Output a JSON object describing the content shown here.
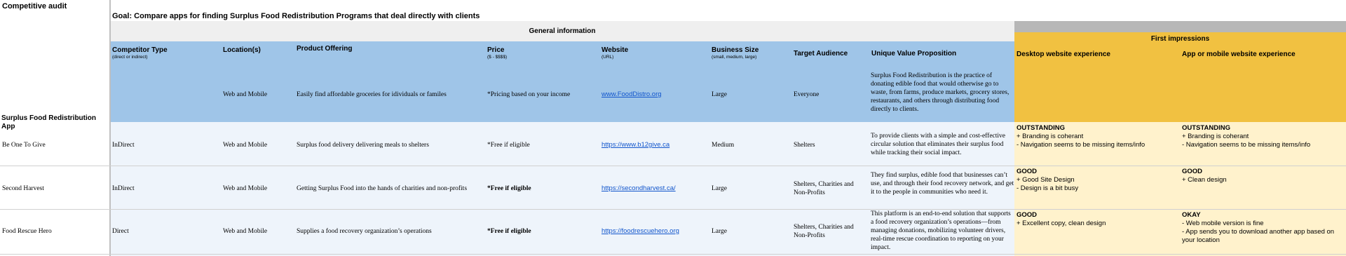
{
  "sheet": {
    "title": "Competitive audit",
    "goal": "Goal: Compare apps for finding Surplus Food Redistribution Programs that deal directly with clients",
    "app_label": "Surplus Food Redistribution App"
  },
  "groups": {
    "general": "General information",
    "impressions": "First impressions"
  },
  "columns": [
    {
      "label": "Competitor Type",
      "sub": "(direct or indirect)"
    },
    {
      "label": "Location(s)",
      "sub": ""
    },
    {
      "label": "Product Offering",
      "sub": ""
    },
    {
      "label": "Price",
      "sub": "($ - $$$$)"
    },
    {
      "label": "Website",
      "sub": "(URL)"
    },
    {
      "label": "Business Size",
      "sub": "(small, medium, large)"
    },
    {
      "label": "Target Audience",
      "sub": ""
    },
    {
      "label": "Unique Value Proposition",
      "sub": ""
    },
    {
      "label": "Desktop website experience",
      "sub": ""
    },
    {
      "label": "App or mobile website experience",
      "sub": ""
    }
  ],
  "own_app": {
    "type": "",
    "location": "Web and Mobile",
    "offering": "Easily find affordable groceries for idividuals or familes",
    "price": "*Pricing based on your income",
    "website": "www.FoodDistro.org",
    "size": "Large",
    "audience": "Everyone",
    "uvp": "Surplus Food Redistribution is the practice of donating edible food that would otherwise go to waste, from farms, produce markets, grocery stores, restaurants, and others through distributing food directly to clients."
  },
  "rows": [
    {
      "name": "Be One To Give",
      "type": "InDirect",
      "location": "Web and Mobile",
      "offering": "Surplus food delivery delivering meals to shelters",
      "price": "*Free if eligible",
      "website": "https://www.b12give.ca",
      "size": "Medium",
      "audience": "Shelters",
      "uvp": "To provide clients with a simple and cost-effective circular solution that eliminates their surplus food while tracking their social impact.",
      "desktop": {
        "rating": "OUTSTANDING",
        "notes": [
          "+ Branding is coherant",
          "- Navigation seems to be missing items/info"
        ]
      },
      "mobile": {
        "rating": "OUTSTANDING",
        "notes": [
          "+ Branding is coherant",
          "- Navigation seems to be missing items/info"
        ]
      }
    },
    {
      "name": "Second Harvest",
      "type": "InDirect",
      "location": "Web and Mobile",
      "offering": "Getting Surplus Food into the hands of charities and non-profits",
      "price": "*Free if eligible",
      "website": "https://secondharvest.ca/",
      "size": "Large",
      "audience": "Shelters, Charities and Non-Profits",
      "uvp": "They find surplus, edible food that businesses can’t use, and through their food recovery network, and get it to the people in communities who need it.",
      "desktop": {
        "rating": "GOOD",
        "notes": [
          "+ Good Site Design",
          "- Design is a bit busy"
        ]
      },
      "mobile": {
        "rating": "GOOD",
        "notes": [
          "+ Clean design"
        ]
      }
    },
    {
      "name": "Food Rescue Hero",
      "type": "Direct",
      "location": "Web and Mobile",
      "offering": "Supplies a food recovery organization’s operations",
      "price": "*Free if eligible",
      "website": "https://foodrescuehero.org",
      "size": "Large",
      "audience": "Shelters, Charities and Non-Profits",
      "uvp": "This platform is an end-to-end solution that supports a food recovery organization’s operations—from managing donations, mobilizing volunteer drivers, real-time rescue coordination to reporting on your impact.",
      "desktop": {
        "rating": "GOOD",
        "notes": [
          "+ Excellent copy, clean design"
        ]
      },
      "mobile": {
        "rating": "OKAY",
        "notes": [
          "- Web mobile version is fine",
          "- App sends you to download another app based on your location"
        ]
      }
    }
  ],
  "colors": {
    "header_blue": "#9fc5e8",
    "row_light_blue": "#eef4fb",
    "gold": "#f1c141",
    "light_yellow": "#fff2cc",
    "grey_band": "#efefef",
    "dark_grey": "#b7b7b7",
    "link": "#1155cc"
  }
}
